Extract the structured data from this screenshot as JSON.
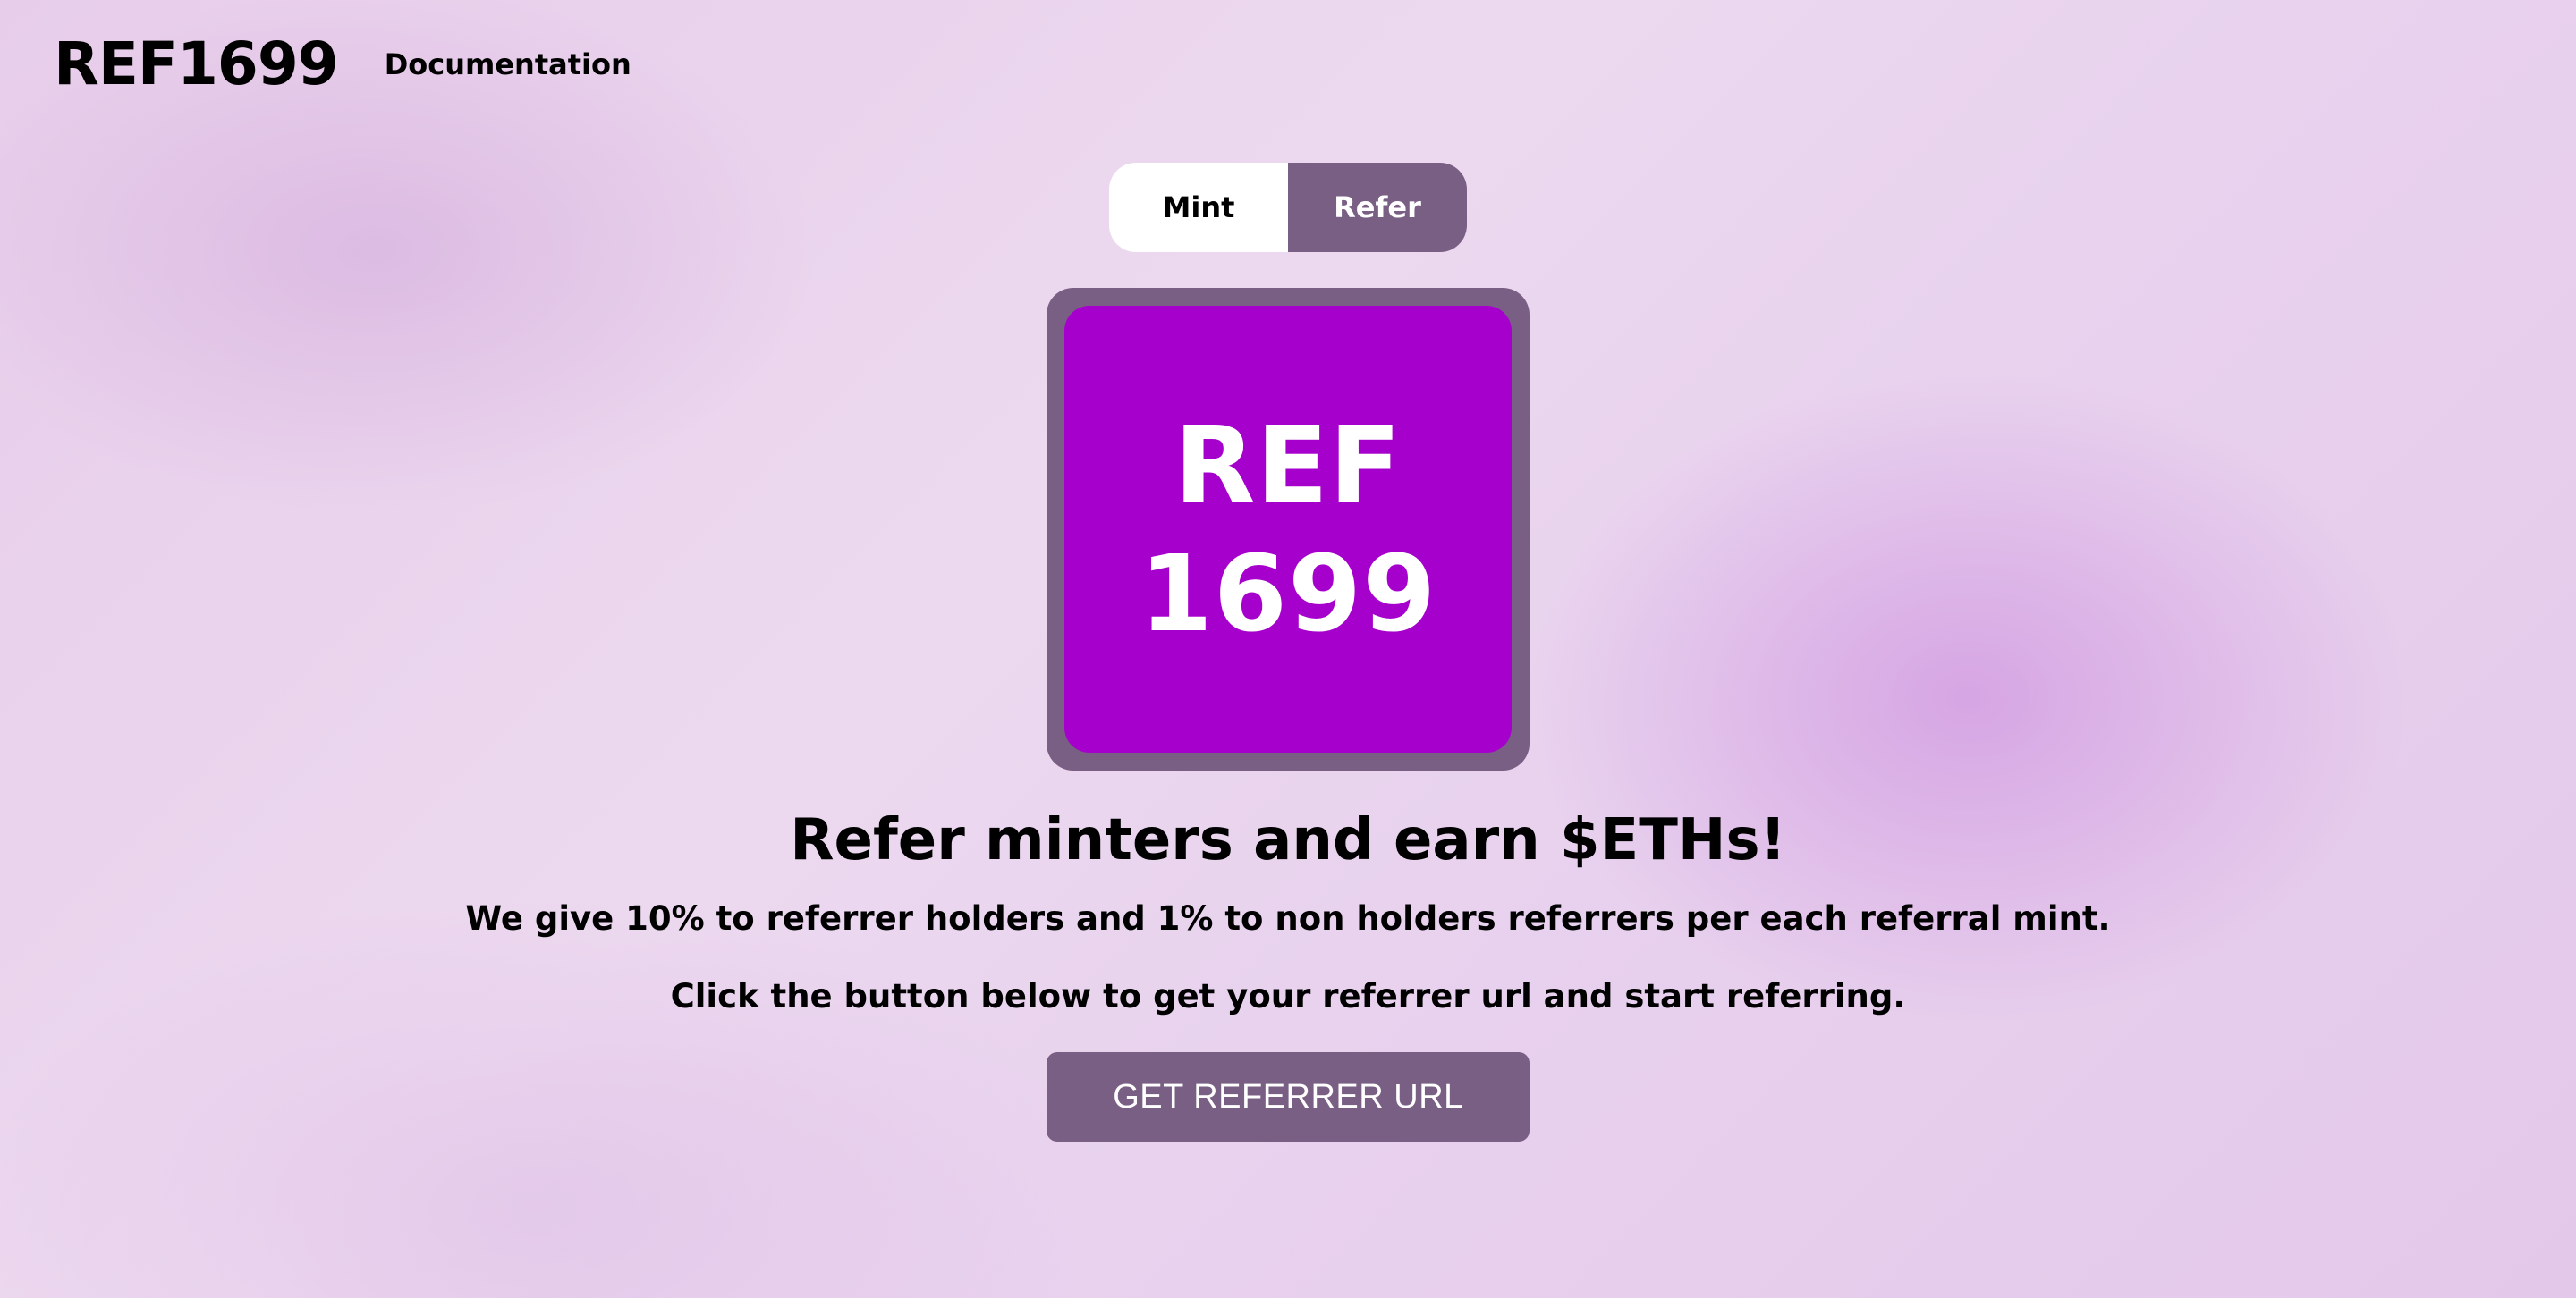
{
  "header": {
    "logo": "REF1699",
    "nav": {
      "documentation": "Documentation"
    }
  },
  "toggle": {
    "mint_label": "Mint",
    "refer_label": "Refer",
    "active": "Refer"
  },
  "artwork": {
    "line1": "REF",
    "line2": "1699"
  },
  "main": {
    "headline": "Refer minters and earn $ETHs!",
    "description": "We give 10% to referrer holders and 1% to non holders referrers per each referral mint.",
    "instruction": "Click the button below to get your referrer url and start referring.",
    "cta_label": "GET REFERRER URL"
  },
  "colors": {
    "accent": "#7a5f85",
    "artwork_fill": "#a600cc",
    "background": "#e8d2ee"
  }
}
